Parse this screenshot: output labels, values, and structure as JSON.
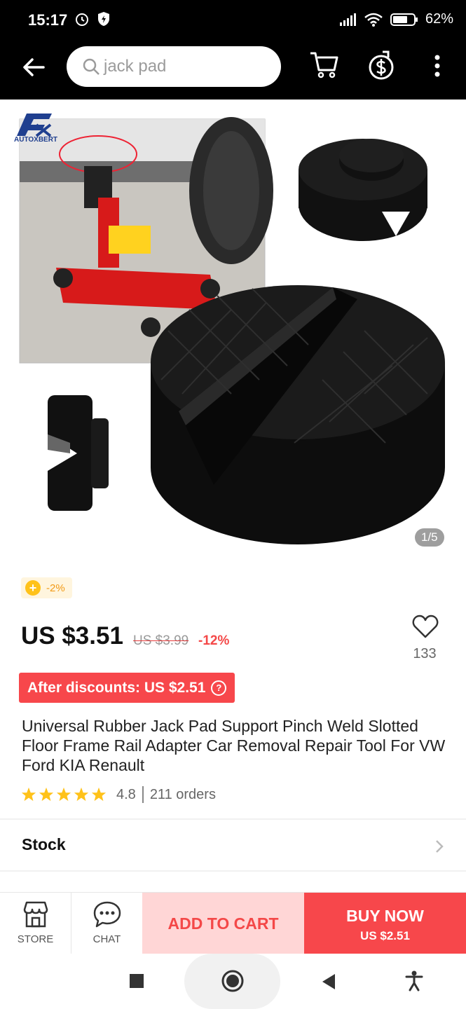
{
  "status": {
    "time": "15:17",
    "battery": "62%"
  },
  "search": {
    "placeholder": "jack pad"
  },
  "gallery": {
    "brand": "AUTOXBERT",
    "counter": "1/5"
  },
  "coupon": {
    "text": "-2%"
  },
  "price": {
    "current": "US $3.51",
    "original": "US $3.99",
    "discount": "-12%"
  },
  "wishlist": {
    "count": "133"
  },
  "after_discount": {
    "label": "After discounts: US $2.51"
  },
  "product": {
    "title": "Universal Rubber Jack Pad Support Pinch Weld Slotted Floor Frame Rail Adapter Car Removal Repair Tool For VW Ford KIA Renault"
  },
  "ratings": {
    "score": "4.8",
    "orders": "211 orders",
    "stars": 5
  },
  "stock": {
    "label": "Stock"
  },
  "bottom": {
    "store": "STORE",
    "chat": "CHAT",
    "add_to_cart": "ADD TO CART",
    "buy_now": "BUY NOW",
    "buy_price": "US $2.51"
  },
  "colors": {
    "accent": "#f7474b",
    "coupon": "#ffc21a"
  }
}
